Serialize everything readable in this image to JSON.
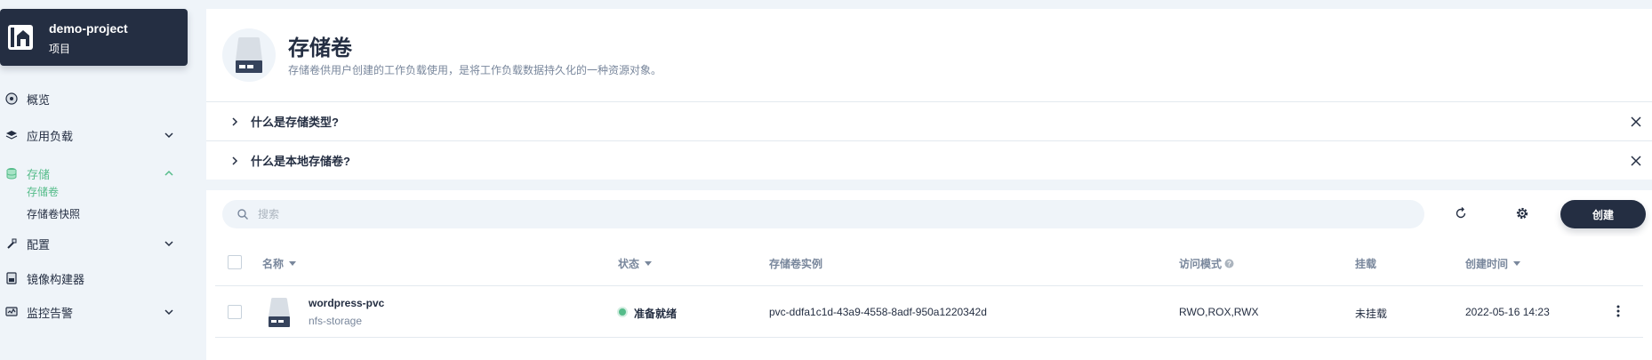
{
  "project": {
    "name": "demo-project",
    "type": "项目"
  },
  "nav": {
    "overview": "概览",
    "workloads": "应用负载",
    "storage": "存储",
    "storage_sub": [
      "存储卷",
      "存储卷快照"
    ],
    "config": "配置",
    "image_builder": "镜像构建器",
    "monitoring": "监控告警"
  },
  "header": {
    "title": "存储卷",
    "description": "存储卷供用户创建的工作负载使用，是将工作负载数据持久化的一种资源对象。"
  },
  "faq": [
    {
      "label": "什么是存储类型?"
    },
    {
      "label": "什么是本地存储卷?"
    }
  ],
  "toolbar": {
    "search_placeholder": "搜索",
    "create_label": "创建"
  },
  "table": {
    "columns": [
      "名称",
      "状态",
      "存储卷实例",
      "访问模式",
      "挂载",
      "创建时间"
    ],
    "rows": [
      {
        "name": "wordpress-pvc",
        "storage_class": "nfs-storage",
        "status": "准备就绪",
        "volume": "pvc-ddfa1c1d-43a9-4558-8adf-950a1220342d",
        "access_mode": "RWO,ROX,RWX",
        "mount": "未挂载",
        "created": "2022-05-16 14:23"
      }
    ]
  },
  "colors": {
    "accent": "#55bc8a",
    "dark": "#242e42",
    "muted": "#79879c",
    "background": "#eff4f9"
  }
}
